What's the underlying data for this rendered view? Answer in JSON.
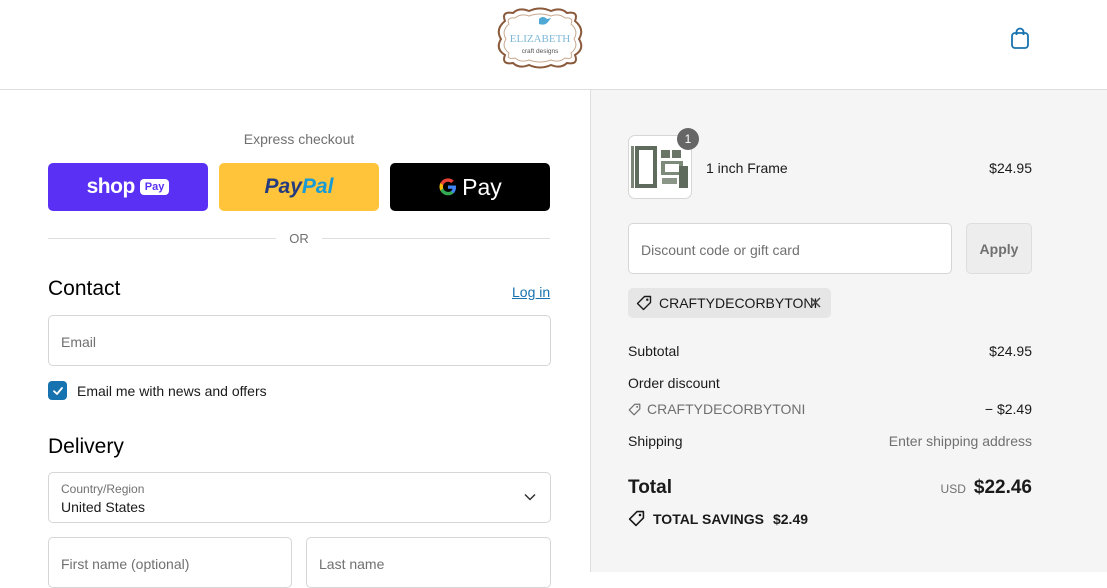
{
  "header": {
    "logo_top": "ELIZABETH",
    "logo_bottom": "craft designs",
    "cart_icon": "shopping-bag-icon"
  },
  "express": {
    "title": "Express checkout",
    "shop_word": "shop",
    "shop_pay": "Pay",
    "paypal_a": "Pay",
    "paypal_b": "Pal",
    "gpay": "Pay",
    "or": "OR"
  },
  "contact": {
    "title": "Contact",
    "login": "Log in",
    "email_placeholder": "Email",
    "newsletter_label": "Email me with news and offers",
    "newsletter_checked": true
  },
  "delivery": {
    "title": "Delivery",
    "country_label": "Country/Region",
    "country_value": "United States",
    "first_name_placeholder": "First name (optional)",
    "last_name_placeholder": "Last name"
  },
  "order": {
    "item": {
      "name": "1 inch Frame",
      "price": "$24.95",
      "quantity": "1"
    },
    "discount_placeholder": "Discount code or gift card",
    "apply_label": "Apply",
    "applied_code": "CRAFTYDECORBYTONI",
    "subtotal_label": "Subtotal",
    "subtotal_value": "$24.95",
    "order_discount_label": "Order discount",
    "discount_code": "CRAFTYDECORBYTONI",
    "discount_value": "− $2.49",
    "shipping_label": "Shipping",
    "shipping_value": "Enter shipping address",
    "total_label": "Total",
    "currency": "USD",
    "total_value": "$22.46",
    "savings_label": "TOTAL SAVINGS",
    "savings_value": "$2.49"
  },
  "colors": {
    "shop_pay": "#5a31f4",
    "paypal": "#ffc439",
    "gpay": "#000000",
    "link": "#1773b0"
  }
}
